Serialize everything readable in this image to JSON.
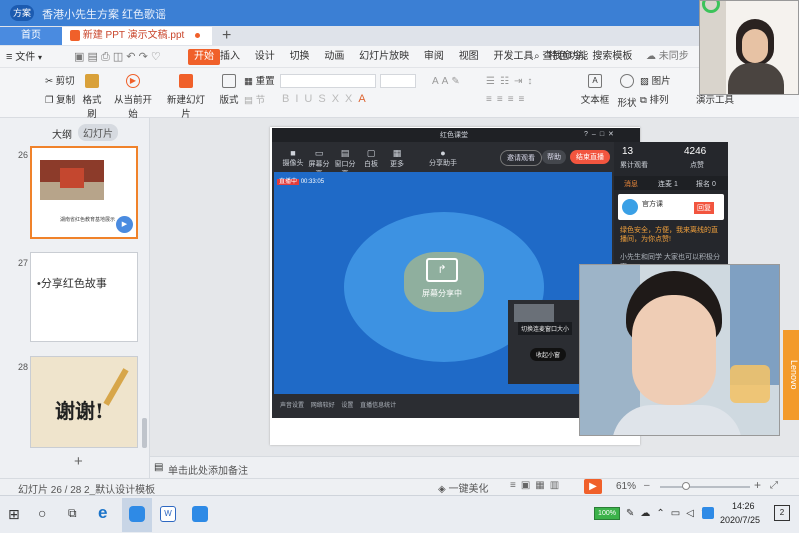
{
  "window": {
    "app_badge": "方案",
    "title": "香港小先生方案 红色歌谣"
  },
  "tabs": [
    {
      "label": "首页"
    },
    {
      "label": "新建 PPT 演示文稿.ppt"
    }
  ],
  "menu": {
    "file": "文件",
    "items": [
      "开始",
      "插入",
      "设计",
      "切换",
      "动画",
      "幻灯片放映",
      "审阅",
      "视图",
      "开发工具",
      "特色功能"
    ],
    "search": "查找命令、搜索模板",
    "sync": "未同步",
    "collab": "协"
  },
  "ribbon": {
    "cut": "剪切",
    "copy": "复制",
    "format_painter": "格式刷",
    "play_from_current": "从当前开始",
    "new_slide": "新建幻灯片",
    "layout": "版式",
    "reset": "重置",
    "section": "节",
    "textbox": "文本框",
    "shape": "形状",
    "arrange": "排列",
    "picture": "图片",
    "fill": "填充",
    "presentation_tool": "演示工具"
  },
  "left": {
    "outline_tab": "大纲",
    "slides_tab": "幻灯片",
    "slides": [
      {
        "num": "26",
        "caption": "湖南省红色教育基地展示"
      },
      {
        "num": "27",
        "bullet": "•分享红色故事"
      },
      {
        "num": "28",
        "thanks": "谢谢!"
      }
    ],
    "add": "+"
  },
  "live": {
    "window_title": "红色课堂",
    "toolbar": [
      "摄像头",
      "屏幕分享",
      "窗口分享",
      "白板",
      "更多"
    ],
    "share_tool": "分享助手",
    "btn_invite": "邀请观看",
    "btn_help": "帮助",
    "btn_end": "结束直播",
    "rec_label": "直播中",
    "rec_time": "00:33:05",
    "screen_sharing": "屏幕分享中",
    "stats": [
      {
        "value": "13",
        "label": "累计观看"
      },
      {
        "value": "4246",
        "label": "点赞"
      }
    ],
    "side_tabs": [
      "消息",
      "连麦 1",
      "报名 0"
    ],
    "chat_user": "官方课",
    "chat_btn": "回复",
    "chat_notice": "绿色安全，方便，我来离线的直播间，为你点赞!",
    "chat_small": "小先生和同学 大家也可以积极分享",
    "popup1": "切换连麦窗口大小",
    "popup2": "收起小窗",
    "bottom": [
      "声音设置",
      "网络较好",
      "设置",
      "直播信息统计"
    ]
  },
  "notes": "单击此处添加备注",
  "status": {
    "slide_info": "幻灯片 26 / 28",
    "template": "2_默认设计模板",
    "beautify": "一键美化",
    "zoom": "61%"
  },
  "taskbar": {
    "time": "14:26",
    "date": "2020/7/25",
    "battery": "100%",
    "notifications": "2"
  },
  "side_text": {
    "lenovo": "Lenovo"
  },
  "colors": {
    "accent": "#3b7fd4",
    "wps_orange": "#f0602a",
    "live_red": "#f2553f"
  }
}
